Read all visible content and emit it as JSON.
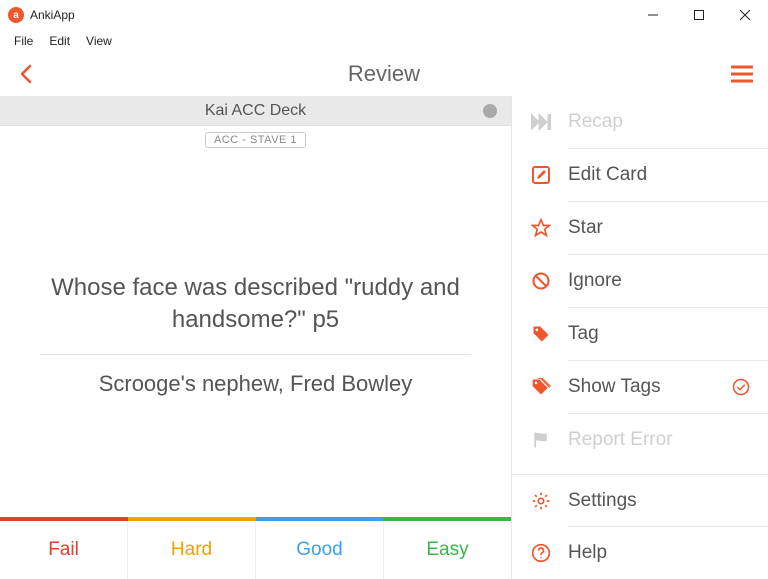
{
  "window": {
    "appName": "AnkiApp"
  },
  "menubar": {
    "file": "File",
    "edit": "Edit",
    "view": "View"
  },
  "header": {
    "title": "Review"
  },
  "deck": {
    "name": "Kai ACC Deck",
    "tag": "ACC - STAVE 1"
  },
  "card": {
    "question": "Whose face was described \"ruddy and handsome?\" p5",
    "answer": "Scrooge's nephew, Fred Bowley"
  },
  "ratings": {
    "fail": {
      "label": "Fail",
      "color": "#e63b2e"
    },
    "hard": {
      "label": "Hard",
      "color": "#f0a000"
    },
    "good": {
      "label": "Good",
      "color": "#3aa0ef"
    },
    "easy": {
      "label": "Easy",
      "color": "#3bb54a"
    }
  },
  "sidemenu": {
    "recap": "Recap",
    "editCard": "Edit Card",
    "star": "Star",
    "ignore": "Ignore",
    "tag": "Tag",
    "showTags": "Show Tags",
    "reportError": "Report Error",
    "settings": "Settings",
    "help": "Help"
  },
  "colors": {
    "accent": "#f0562c"
  }
}
